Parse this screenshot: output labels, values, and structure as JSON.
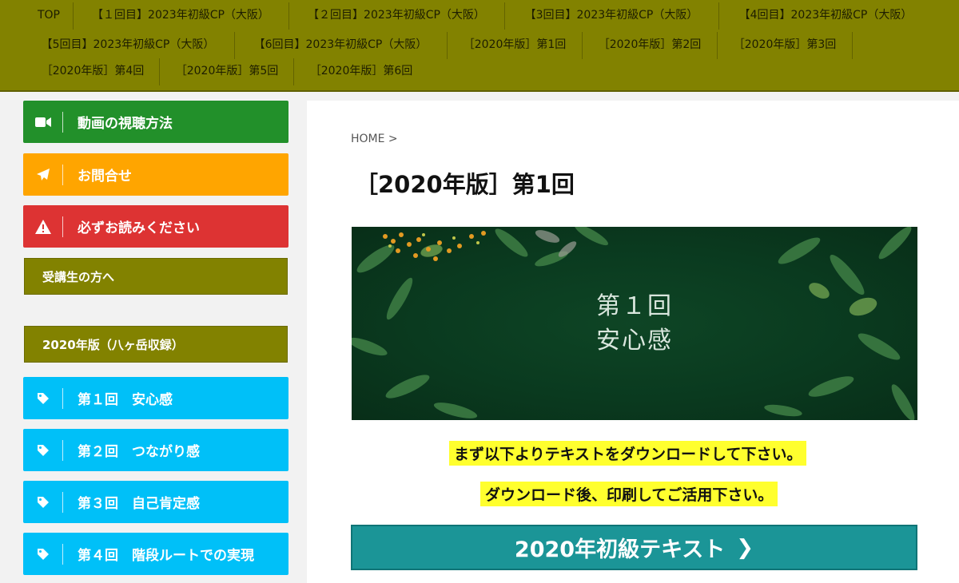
{
  "nav": {
    "items": [
      "TOP",
      "【１回目】2023年初級CP（大阪）",
      "【２回目】2023年初級CP（大阪）",
      "【3回目】2023年初級CP（大阪）",
      "【4回目】2023年初級CP（大阪）",
      "【5回目】2023年初級CP（大阪）",
      "【6回目】2023年初級CP（大阪）",
      "［2020年版］第1回",
      "［2020年版］第2回",
      "［2020年版］第3回",
      "［2020年版］第4回",
      "［2020年版］第5回",
      "［2020年版］第6回"
    ]
  },
  "sidebar": {
    "buttons": [
      {
        "label": "動画の視聴方法",
        "icon": "video-camera-icon",
        "color": "#22902a"
      },
      {
        "label": "お問合せ",
        "icon": "paper-plane-icon",
        "color": "#ffa500"
      },
      {
        "label": "必ずお読みください",
        "icon": "warning-icon",
        "color": "#dd3333"
      }
    ],
    "heading_students": "受講生の方へ",
    "heading_2020": "2020年版（八ヶ岳収録）",
    "lessons": [
      {
        "label": "第１回　安心感",
        "icon": "tag-icon"
      },
      {
        "label": "第２回　つながり感",
        "icon": "tag-icon"
      },
      {
        "label": "第３回　自己肯定感",
        "icon": "tag-icon"
      },
      {
        "label": "第４回　階段ルートでの実現",
        "icon": "tag-icon"
      }
    ],
    "lesson_color": "#00c0f8"
  },
  "main": {
    "breadcrumb": "HOME >",
    "title": "［2020年版］第1回",
    "hero_line1": "第１回",
    "hero_line2": "安心感",
    "highlight1": "まず以下よりテキストをダウンロードして下さい。",
    "highlight2": "ダウンロード後、印刷してご活用下さい。",
    "download_label": "2020年初級テキスト",
    "download_chevron": "❯"
  }
}
